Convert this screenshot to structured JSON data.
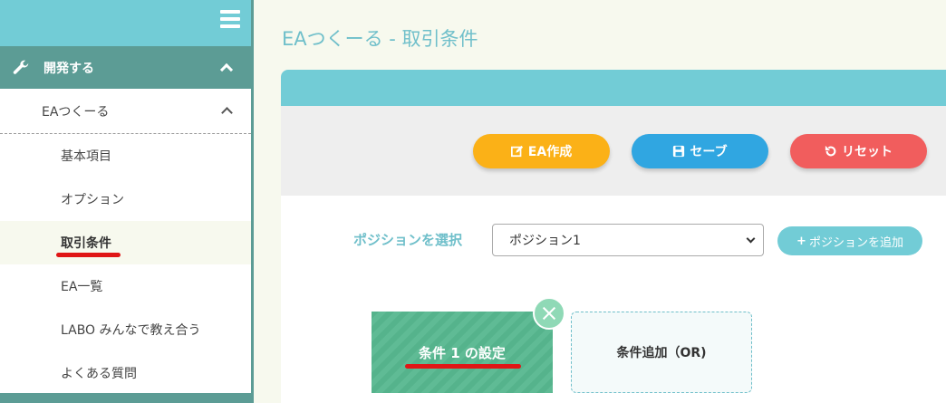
{
  "sidebar": {
    "section": {
      "label": "開発する",
      "icon": "wrench-icon"
    },
    "group": {
      "label": "EAつくーる"
    },
    "items": [
      {
        "label": "基本項目"
      },
      {
        "label": "オプション"
      },
      {
        "label": "取引条件"
      },
      {
        "label": "EA一覧"
      },
      {
        "label": "LABO みんなで教え合う"
      },
      {
        "label": "よくある質問"
      }
    ]
  },
  "page": {
    "title": "EAつくーる - 取引条件"
  },
  "toolbar": {
    "create_label": "EA作成",
    "save_label": "セーブ",
    "reset_label": "リセット"
  },
  "position": {
    "label": "ポジションを選択",
    "selected": "ポジション1",
    "add_label": "ポジションを追加"
  },
  "conditions": {
    "card_label": "条件 1 の設定",
    "add_label": "条件追加（OR)"
  },
  "colors": {
    "accent": "#72ccd6",
    "sidebar_dark": "#5c9c95",
    "create": "#fbb117",
    "save": "#30a6e1",
    "reset": "#f15d5d",
    "condition": "#55b38c"
  }
}
